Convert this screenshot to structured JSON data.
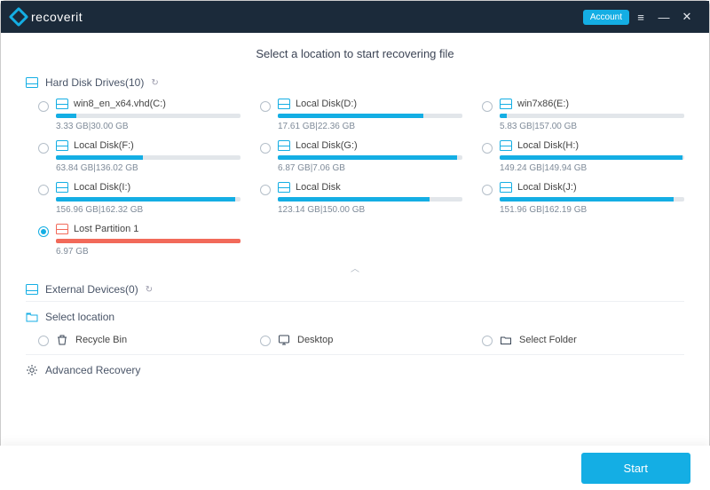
{
  "brand": "recoverit",
  "titlebar": {
    "account_label": "Account"
  },
  "page_title": "Select a location to start recovering file",
  "sections": {
    "hdd": {
      "label": "Hard Disk Drives(10)"
    },
    "ext": {
      "label": "External Devices(0)"
    },
    "loc": {
      "label": "Select location"
    },
    "adv": {
      "label": "Advanced Recovery"
    }
  },
  "drives": [
    {
      "name": "win8_en_x64.vhd(C:)",
      "used": "3.33  GB",
      "total": "30.00  GB",
      "pct": 11,
      "selected": false,
      "lost": false
    },
    {
      "name": "Local Disk(D:)",
      "used": "17.61  GB",
      "total": "22.36  GB",
      "pct": 79,
      "selected": false,
      "lost": false
    },
    {
      "name": "win7x86(E:)",
      "used": "5.83  GB",
      "total": "157.00  GB",
      "pct": 4,
      "selected": false,
      "lost": false
    },
    {
      "name": "Local Disk(F:)",
      "used": "63.84  GB",
      "total": "136.02  GB",
      "pct": 47,
      "selected": false,
      "lost": false
    },
    {
      "name": "Local Disk(G:)",
      "used": "6.87  GB",
      "total": "7.06  GB",
      "pct": 97,
      "selected": false,
      "lost": false
    },
    {
      "name": "Local Disk(H:)",
      "used": "149.24  GB",
      "total": "149.94  GB",
      "pct": 99,
      "selected": false,
      "lost": false
    },
    {
      "name": "Local Disk(I:)",
      "used": "156.96  GB",
      "total": "162.32  GB",
      "pct": 97,
      "selected": false,
      "lost": false
    },
    {
      "name": "Local Disk",
      "used": "123.14  GB",
      "total": "150.00  GB",
      "pct": 82,
      "selected": false,
      "lost": false
    },
    {
      "name": "Local Disk(J:)",
      "used": "151.96  GB",
      "total": "162.19  GB",
      "pct": 94,
      "selected": false,
      "lost": false
    },
    {
      "name": "Lost Partition 1",
      "used": "6.97  GB",
      "total": "",
      "pct": 100,
      "selected": true,
      "lost": true
    }
  ],
  "locations": [
    {
      "name": "Recycle Bin",
      "icon": "recycle-bin-icon"
    },
    {
      "name": "Desktop",
      "icon": "desktop-icon"
    },
    {
      "name": "Select Folder",
      "icon": "folder-icon"
    }
  ],
  "footer": {
    "start_label": "Start"
  }
}
